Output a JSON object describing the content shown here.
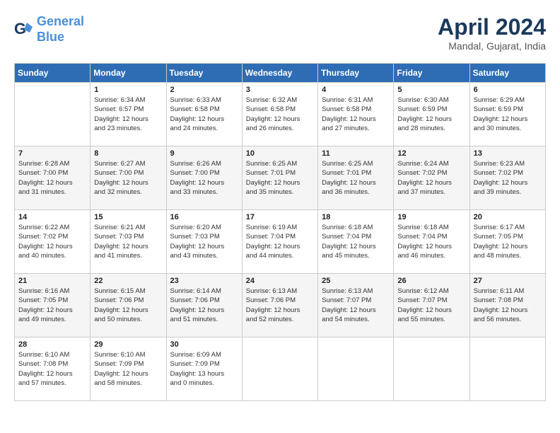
{
  "header": {
    "logo_line1": "General",
    "logo_line2": "Blue",
    "month_title": "April 2024",
    "location": "Mandal, Gujarat, India"
  },
  "columns": [
    "Sunday",
    "Monday",
    "Tuesday",
    "Wednesday",
    "Thursday",
    "Friday",
    "Saturday"
  ],
  "weeks": [
    [
      {
        "num": "",
        "info": ""
      },
      {
        "num": "1",
        "info": "Sunrise: 6:34 AM\nSunset: 6:57 PM\nDaylight: 12 hours\nand 23 minutes."
      },
      {
        "num": "2",
        "info": "Sunrise: 6:33 AM\nSunset: 6:58 PM\nDaylight: 12 hours\nand 24 minutes."
      },
      {
        "num": "3",
        "info": "Sunrise: 6:32 AM\nSunset: 6:58 PM\nDaylight: 12 hours\nand 26 minutes."
      },
      {
        "num": "4",
        "info": "Sunrise: 6:31 AM\nSunset: 6:58 PM\nDaylight: 12 hours\nand 27 minutes."
      },
      {
        "num": "5",
        "info": "Sunrise: 6:30 AM\nSunset: 6:59 PM\nDaylight: 12 hours\nand 28 minutes."
      },
      {
        "num": "6",
        "info": "Sunrise: 6:29 AM\nSunset: 6:59 PM\nDaylight: 12 hours\nand 30 minutes."
      }
    ],
    [
      {
        "num": "7",
        "info": "Sunrise: 6:28 AM\nSunset: 7:00 PM\nDaylight: 12 hours\nand 31 minutes."
      },
      {
        "num": "8",
        "info": "Sunrise: 6:27 AM\nSunset: 7:00 PM\nDaylight: 12 hours\nand 32 minutes."
      },
      {
        "num": "9",
        "info": "Sunrise: 6:26 AM\nSunset: 7:00 PM\nDaylight: 12 hours\nand 33 minutes."
      },
      {
        "num": "10",
        "info": "Sunrise: 6:25 AM\nSunset: 7:01 PM\nDaylight: 12 hours\nand 35 minutes."
      },
      {
        "num": "11",
        "info": "Sunrise: 6:25 AM\nSunset: 7:01 PM\nDaylight: 12 hours\nand 36 minutes."
      },
      {
        "num": "12",
        "info": "Sunrise: 6:24 AM\nSunset: 7:02 PM\nDaylight: 12 hours\nand 37 minutes."
      },
      {
        "num": "13",
        "info": "Sunrise: 6:23 AM\nSunset: 7:02 PM\nDaylight: 12 hours\nand 39 minutes."
      }
    ],
    [
      {
        "num": "14",
        "info": "Sunrise: 6:22 AM\nSunset: 7:02 PM\nDaylight: 12 hours\nand 40 minutes."
      },
      {
        "num": "15",
        "info": "Sunrise: 6:21 AM\nSunset: 7:03 PM\nDaylight: 12 hours\nand 41 minutes."
      },
      {
        "num": "16",
        "info": "Sunrise: 6:20 AM\nSunset: 7:03 PM\nDaylight: 12 hours\nand 43 minutes."
      },
      {
        "num": "17",
        "info": "Sunrise: 6:19 AM\nSunset: 7:04 PM\nDaylight: 12 hours\nand 44 minutes."
      },
      {
        "num": "18",
        "info": "Sunrise: 6:18 AM\nSunset: 7:04 PM\nDaylight: 12 hours\nand 45 minutes."
      },
      {
        "num": "19",
        "info": "Sunrise: 6:18 AM\nSunset: 7:04 PM\nDaylight: 12 hours\nand 46 minutes."
      },
      {
        "num": "20",
        "info": "Sunrise: 6:17 AM\nSunset: 7:05 PM\nDaylight: 12 hours\nand 48 minutes."
      }
    ],
    [
      {
        "num": "21",
        "info": "Sunrise: 6:16 AM\nSunset: 7:05 PM\nDaylight: 12 hours\nand 49 minutes."
      },
      {
        "num": "22",
        "info": "Sunrise: 6:15 AM\nSunset: 7:06 PM\nDaylight: 12 hours\nand 50 minutes."
      },
      {
        "num": "23",
        "info": "Sunrise: 6:14 AM\nSunset: 7:06 PM\nDaylight: 12 hours\nand 51 minutes."
      },
      {
        "num": "24",
        "info": "Sunrise: 6:13 AM\nSunset: 7:06 PM\nDaylight: 12 hours\nand 52 minutes."
      },
      {
        "num": "25",
        "info": "Sunrise: 6:13 AM\nSunset: 7:07 PM\nDaylight: 12 hours\nand 54 minutes."
      },
      {
        "num": "26",
        "info": "Sunrise: 6:12 AM\nSunset: 7:07 PM\nDaylight: 12 hours\nand 55 minutes."
      },
      {
        "num": "27",
        "info": "Sunrise: 6:11 AM\nSunset: 7:08 PM\nDaylight: 12 hours\nand 56 minutes."
      }
    ],
    [
      {
        "num": "28",
        "info": "Sunrise: 6:10 AM\nSunset: 7:08 PM\nDaylight: 12 hours\nand 57 minutes."
      },
      {
        "num": "29",
        "info": "Sunrise: 6:10 AM\nSunset: 7:09 PM\nDaylight: 12 hours\nand 58 minutes."
      },
      {
        "num": "30",
        "info": "Sunrise: 6:09 AM\nSunset: 7:09 PM\nDaylight: 13 hours\nand 0 minutes."
      },
      {
        "num": "",
        "info": ""
      },
      {
        "num": "",
        "info": ""
      },
      {
        "num": "",
        "info": ""
      },
      {
        "num": "",
        "info": ""
      }
    ]
  ]
}
